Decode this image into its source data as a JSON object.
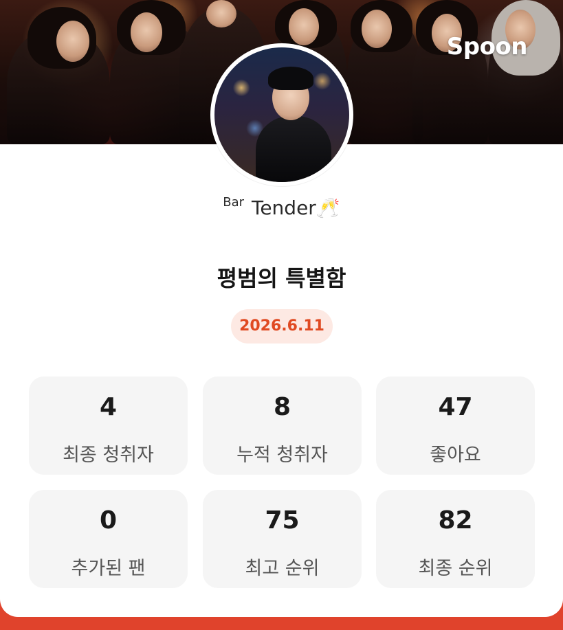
{
  "brand": {
    "logo_text": "Spoon"
  },
  "profile": {
    "nickname_prefix": "Bar",
    "nickname": "Tender",
    "nickname_emoji": "🥂"
  },
  "broadcast": {
    "title": "평범의 특별함",
    "date": "2026.6.11"
  },
  "stats": [
    {
      "value": "4",
      "label": "최종 청취자"
    },
    {
      "value": "8",
      "label": "누적 청취자"
    },
    {
      "value": "47",
      "label": "좋아요"
    },
    {
      "value": "0",
      "label": "추가된 팬"
    },
    {
      "value": "75",
      "label": "최고 순위"
    },
    {
      "value": "82",
      "label": "최종 순위"
    }
  ],
  "colors": {
    "accent": "#e0432c",
    "badge_bg": "#fde9e3",
    "badge_text": "#e04a22",
    "stat_bg": "#f5f5f5"
  }
}
